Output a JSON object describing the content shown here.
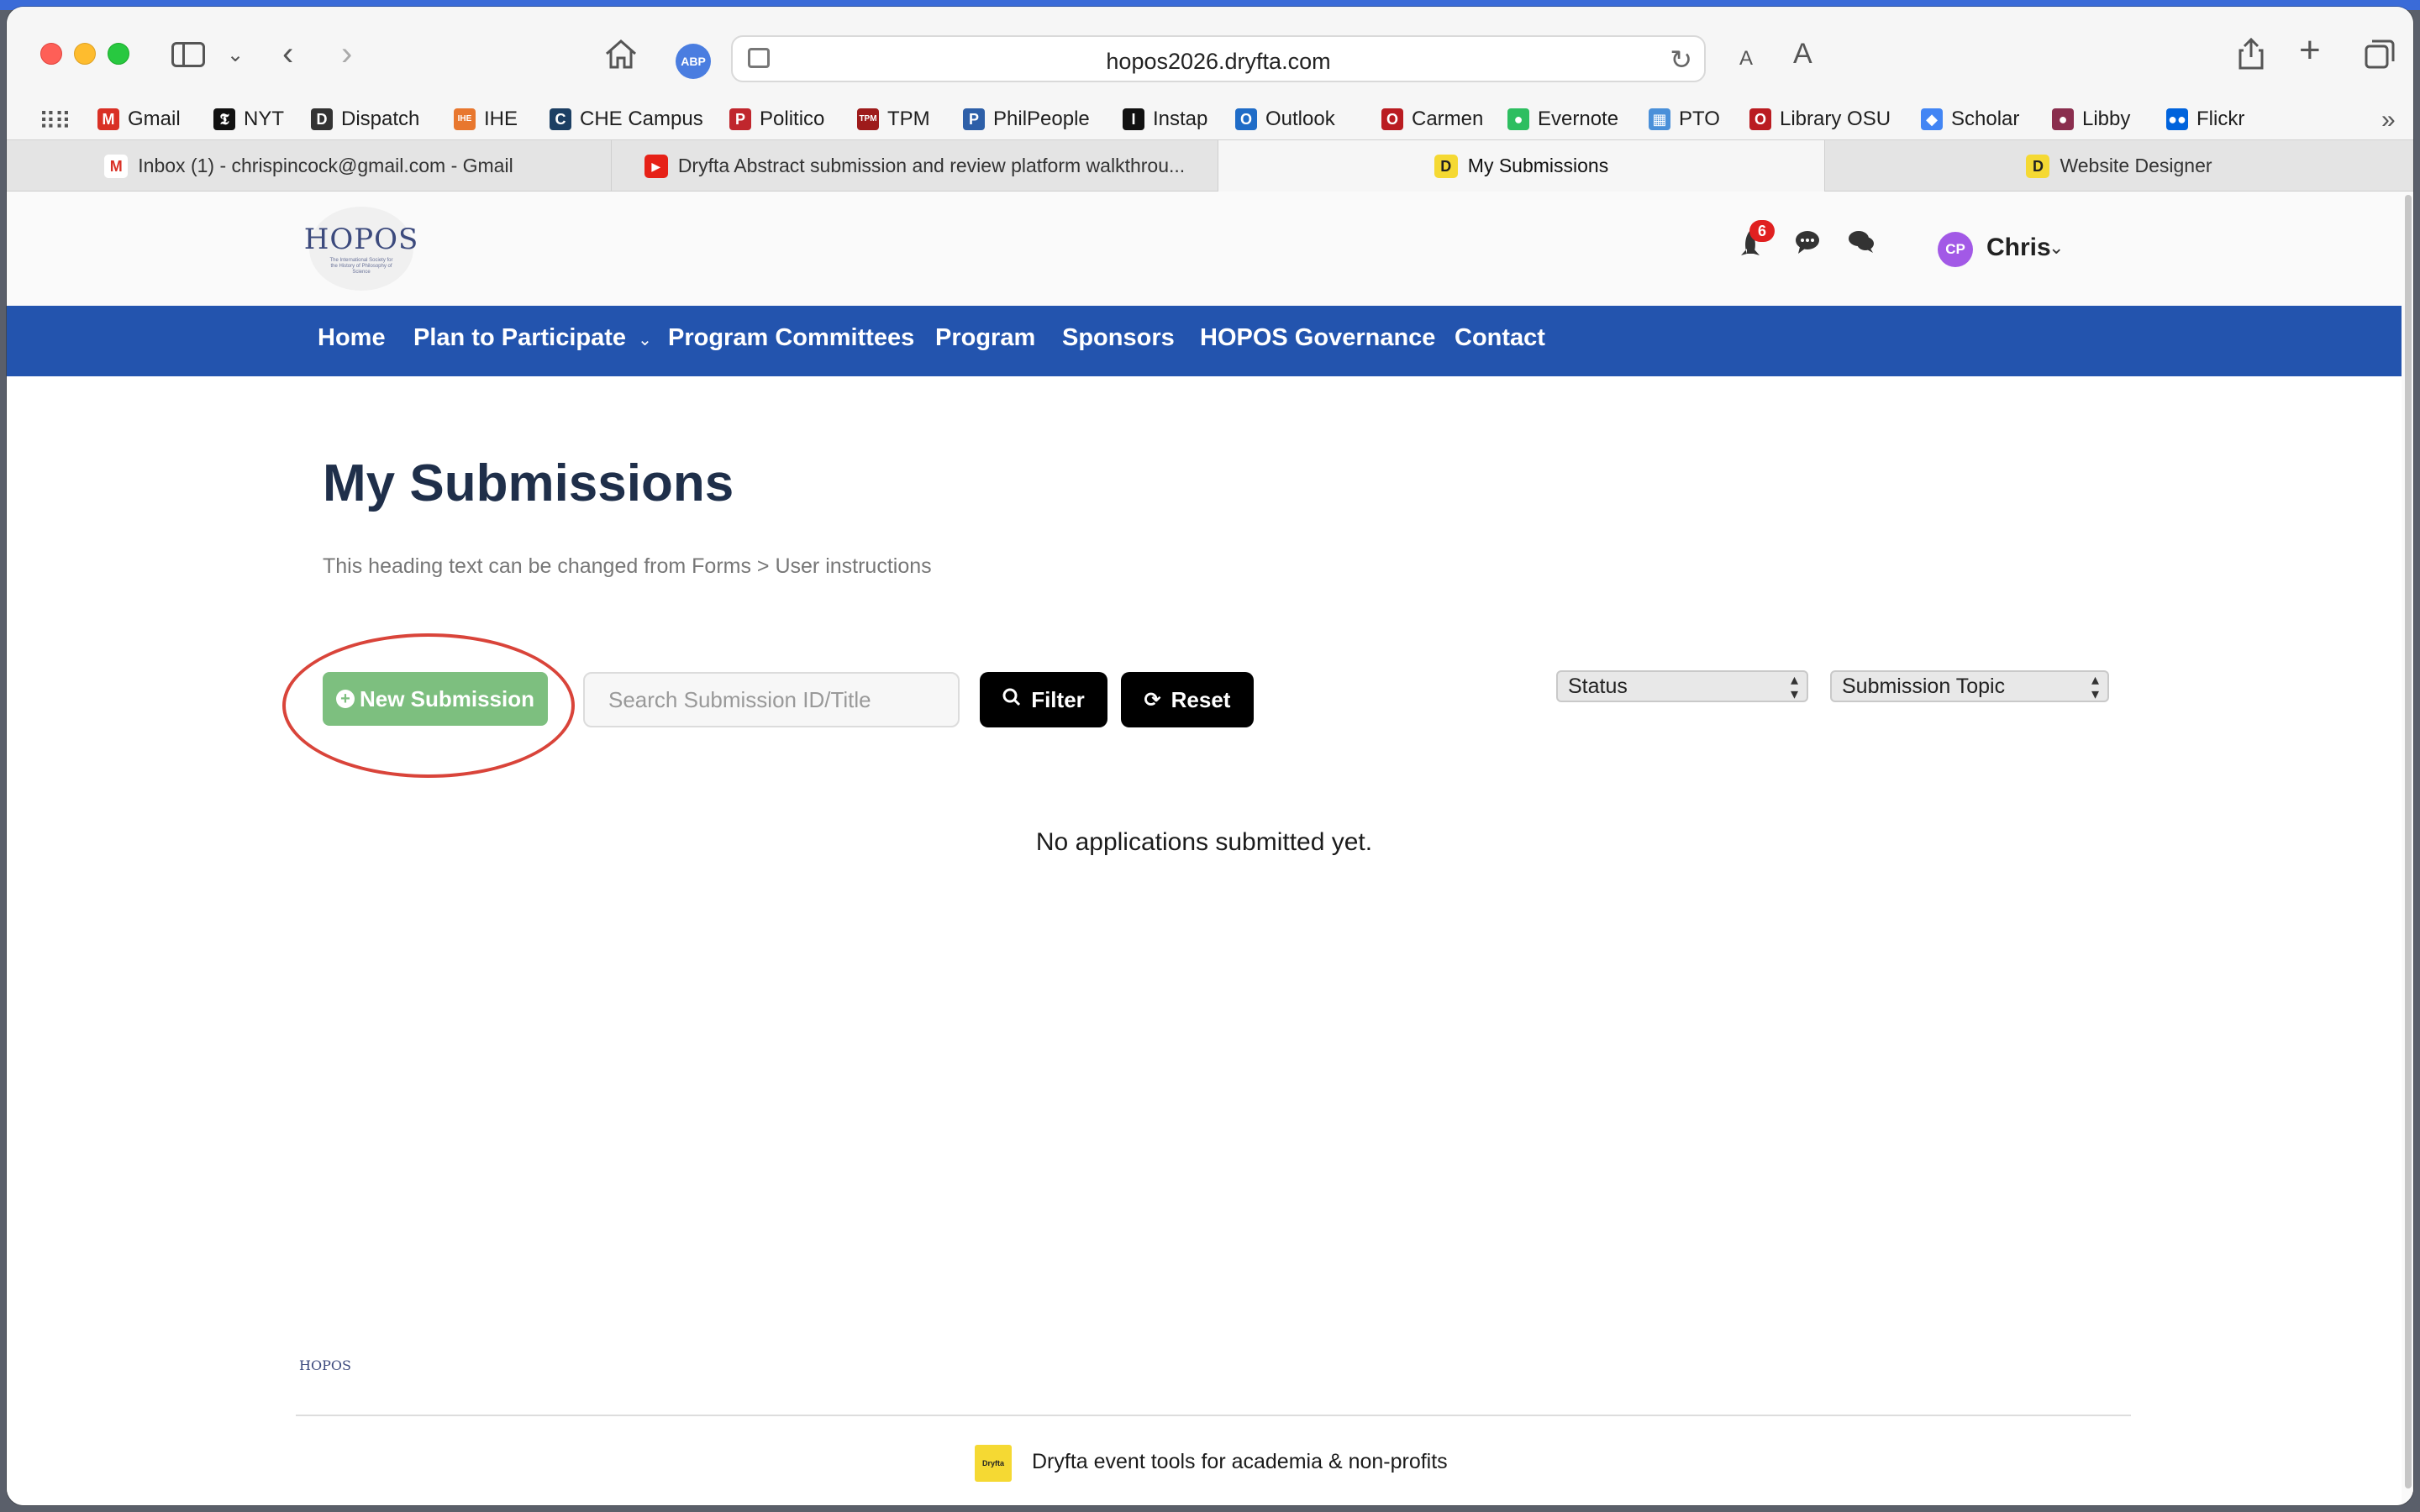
{
  "browser": {
    "url": "hopos2026.dryfta.com",
    "bookmarks": [
      {
        "label": "Gmail",
        "icon": "gmail-icon",
        "color": "#d93025"
      },
      {
        "label": "NYT",
        "icon": "nyt-icon",
        "color": "#111111"
      },
      {
        "label": "Dispatch",
        "icon": "dispatch-icon",
        "color": "#333333"
      },
      {
        "label": "IHE",
        "icon": "ihe-icon",
        "color": "#e8772e"
      },
      {
        "label": "CHE Campus",
        "icon": "che-icon",
        "color": "#1c3f63"
      },
      {
        "label": "Politico",
        "icon": "politico-icon",
        "color": "#c0262d"
      },
      {
        "label": "TPM",
        "icon": "tpm-icon",
        "color": "#9e1b1b"
      },
      {
        "label": "PhilPeople",
        "icon": "philpeople-icon",
        "color": "#2d5fa8"
      },
      {
        "label": "Instap",
        "icon": "instapaper-icon",
        "color": "#111111"
      },
      {
        "label": "Outlook",
        "icon": "outlook-icon",
        "color": "#1f6cc7"
      },
      {
        "label": "Carmen",
        "icon": "carmen-icon",
        "color": "#ba1c21"
      },
      {
        "label": "Evernote",
        "icon": "evernote-icon",
        "color": "#2dbe60"
      },
      {
        "label": "PTO",
        "icon": "pto-icon",
        "color": "#4a90d9"
      },
      {
        "label": "Library OSU",
        "icon": "library-osu-icon",
        "color": "#ba1c21"
      },
      {
        "label": "Scholar",
        "icon": "scholar-icon",
        "color": "#4285f4"
      },
      {
        "label": "Libby",
        "icon": "libby-icon",
        "color": "#8a2e4e"
      },
      {
        "label": "Flickr",
        "icon": "flickr-icon",
        "color": "#0063dc"
      }
    ],
    "tabs": [
      {
        "label": "Inbox (1) - chrispincock@gmail.com - Gmail",
        "icon": "gmail-icon",
        "active": false
      },
      {
        "label": "Dryfta Abstract submission and review platform walkthrou...",
        "icon": "youtube-icon",
        "active": false
      },
      {
        "label": "My Submissions",
        "icon": "dryfta-icon",
        "active": true
      },
      {
        "label": "Website Designer",
        "icon": "dryfta-icon",
        "active": false
      }
    ]
  },
  "site": {
    "logo_word": "HOPOS",
    "logo_sub": "The International Society for the History of Philosophy of Science",
    "notification_count": "6",
    "user": {
      "initials": "CP",
      "name": "Chris"
    },
    "nav": [
      "Home",
      "Plan to Participate",
      "Program Committees",
      "Program",
      "Sponsors",
      "HOPOS Governance",
      "Contact"
    ]
  },
  "main": {
    "title": "My Submissions",
    "subtitle": "This heading text can be changed from Forms > User instructions",
    "new_submission_label": "New Submission",
    "search_placeholder": "Search Submission ID/Title",
    "filter_label": "Filter",
    "reset_label": "Reset",
    "status_select": "Status",
    "topic_select": "Submission Topic",
    "empty_message": "No applications submitted yet."
  },
  "footer": {
    "logo_word": "HOPOS",
    "dryfta_badge": "Dryfta",
    "text": "Dryfta event tools for academia & non-profits"
  },
  "colors": {
    "nav_bg": "#2354ae",
    "new_submission_bg": "#7dbf7f",
    "annotation_circle": "#d9443a",
    "title_color": "#1f2f4a"
  }
}
